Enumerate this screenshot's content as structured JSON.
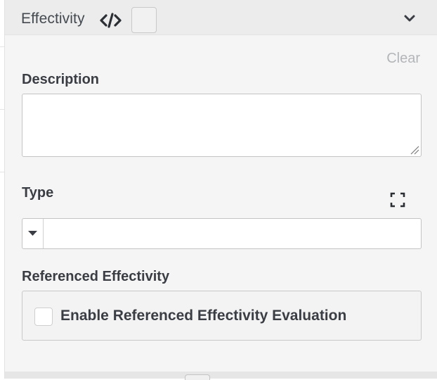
{
  "header": {
    "title": "Effectivity",
    "code_icon": "code-brackets-icon",
    "collapse_icon": "chevron-down-icon"
  },
  "clear_label": "Clear",
  "description": {
    "label": "Description",
    "value": ""
  },
  "type": {
    "label": "Type",
    "expand_icon": "fullscreen-expand-icon",
    "selected_value": ""
  },
  "referenced_effectivity": {
    "label": "Referenced Effectivity",
    "checkbox_label": "Enable Referenced Effectivity Evaluation",
    "checked": false
  },
  "colors": {
    "panel_bg": "#f5f5f5",
    "header_bg": "#ececec",
    "text": "#3a3e44",
    "muted": "#b3b6b9"
  }
}
